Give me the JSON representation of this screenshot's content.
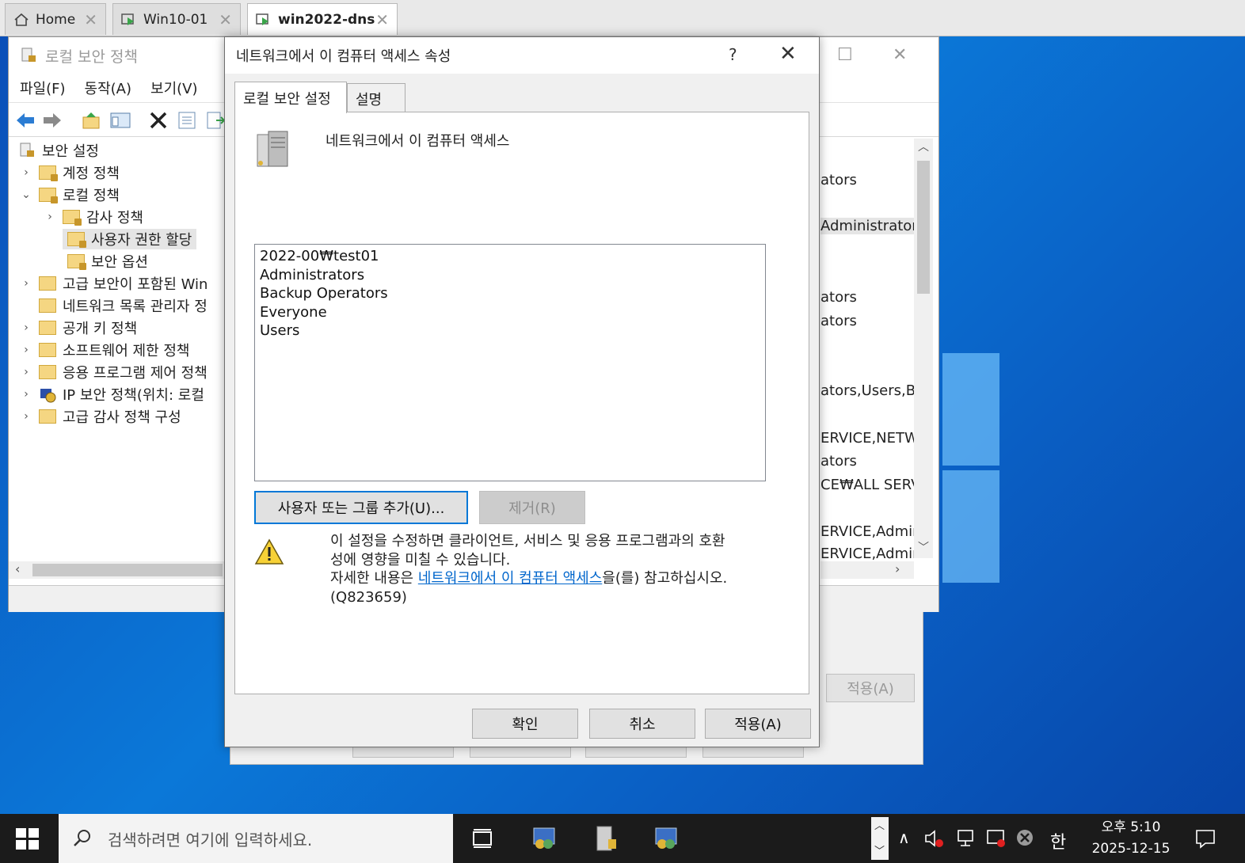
{
  "vm_tabs": [
    {
      "label": "Home"
    },
    {
      "label": "Win10-01"
    },
    {
      "label": "win2022-dns"
    }
  ],
  "mmc": {
    "title": "로컬 보안 정책",
    "menu": [
      "파일(F)",
      "동작(A)",
      "보기(V)"
    ],
    "tree": [
      {
        "label": "보안 설정"
      },
      {
        "label": "계정 정책"
      },
      {
        "label": "로컬 정책"
      },
      {
        "label": "감사 정책"
      },
      {
        "label": "사용자 권한 할당"
      },
      {
        "label": "보안 옵션"
      },
      {
        "label": "고급 보안이 포함된 Win"
      },
      {
        "label": "네트워크 목록 관리자 정"
      },
      {
        "label": "공개 키 정책"
      },
      {
        "label": "소프트웨어 제한 정책"
      },
      {
        "label": "응용 프로그램 제어 정책"
      },
      {
        "label": "IP 보안 정책(위치: 로컬"
      },
      {
        "label": "고급 감사 정책 구성"
      }
    ],
    "right_rows": [
      "ators",
      "Administrator",
      "ators",
      "ators",
      "ators,Users,Ba",
      "ERVICE,NETW",
      "ators",
      "CE₩ALL SERV",
      "ERVICE,Admir",
      "ERVICE,Admir"
    ]
  },
  "ghost": {
    "apply_label": "적용(A)"
  },
  "dialog": {
    "title": "네트워크에서 이 컴퓨터 액세스 속성",
    "help": "?",
    "tabs": [
      "로컬 보안 설정",
      "설명"
    ],
    "heading": "네트워크에서 이 컴퓨터 액세스",
    "members": [
      "2022-00₩test01",
      "Administrators",
      "Backup Operators",
      "Everyone",
      "Users"
    ],
    "add_button": "사용자 또는 그룹 추가(U)...",
    "remove_button": "제거(R)",
    "warning_line1": "이 설정을 수정하면 클라이언트, 서비스 및 응용 프로그램과의 호환",
    "warning_line2": "성에 영향을 미칠 수 있습니다.",
    "warning_prefix": "자세한 내용은 ",
    "warning_link": "네트워크에서 이 컴퓨터 액세스",
    "warning_suffix": "을(를) 참고하십시오.",
    "warning_code": "(Q823659)",
    "ok_button": "확인",
    "cancel_button": "취소",
    "apply_button": "적용(A)"
  },
  "taskbar": {
    "search_placeholder": "검색하려면 여기에 입력하세요.",
    "ime": "한",
    "time": "오후 5:10",
    "date": "2025-12-15"
  }
}
